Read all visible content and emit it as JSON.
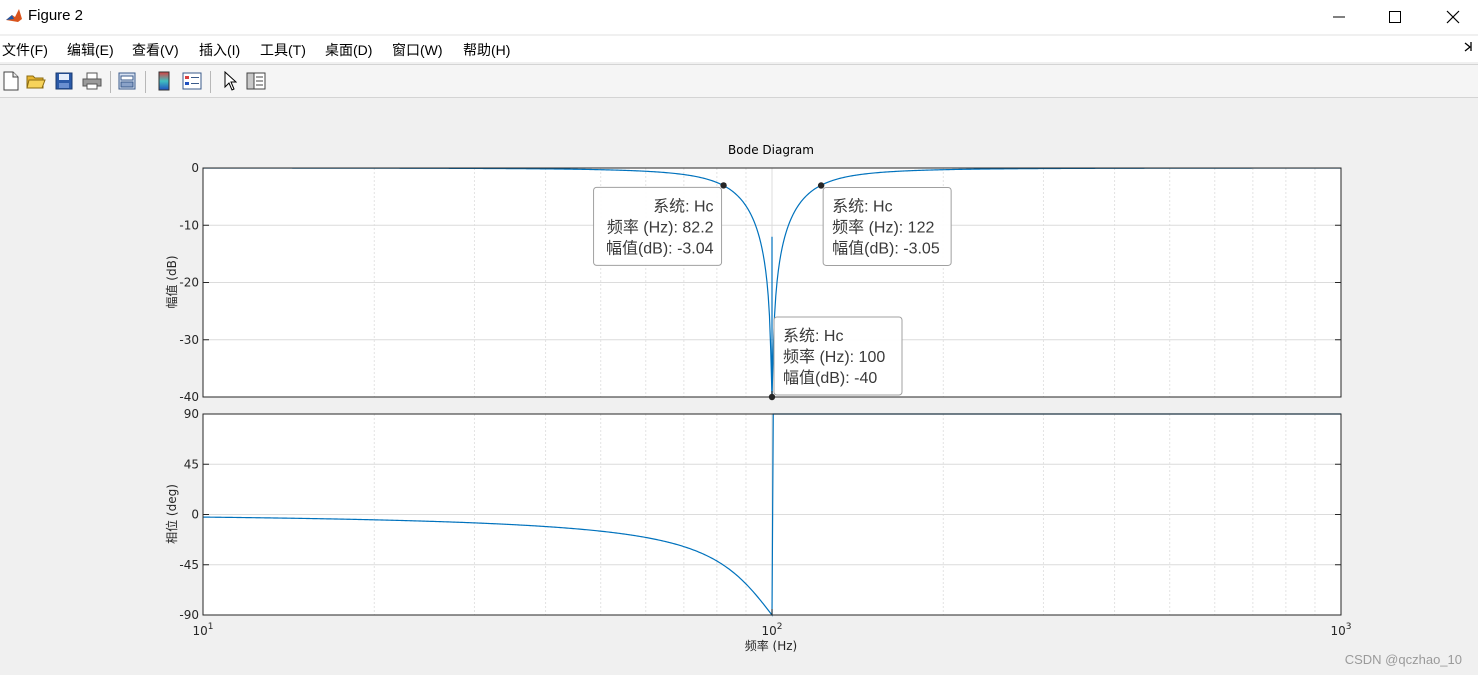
{
  "window": {
    "title": "Figure 2"
  },
  "menu": {
    "items": [
      "文件(F)",
      "编辑(E)",
      "查看(V)",
      "插入(I)",
      "工具(T)",
      "桌面(D)",
      "窗口(W)",
      "帮助(H)"
    ]
  },
  "toolbar": {
    "icons": [
      "new-figure-icon",
      "open-file-icon",
      "save-icon",
      "print-icon",
      "print-preview-icon",
      "colorbar-icon",
      "legend-icon",
      "pointer-icon",
      "property-editor-icon"
    ]
  },
  "chart_data": {
    "type": "line",
    "title": "Bode Diagram",
    "xlabel": "频率  (Hz)",
    "xscale": "log",
    "xlim": [
      10,
      1000
    ],
    "x_ticks": [
      10,
      100,
      1000
    ],
    "x_tick_base": "10",
    "x_tick_exponents": [
      "1",
      "2",
      "3"
    ],
    "system": {
      "type": "notch",
      "center_hz": 100,
      "bandwidth_hz": 40,
      "depth_db": -40
    },
    "magnitude": {
      "ylabel": "幅值 (dB)",
      "ylim": [
        -40,
        0
      ],
      "y_ticks": [
        "0",
        "-10",
        "-20",
        "-30",
        "-40"
      ],
      "points": [
        {
          "x": 10,
          "y": -0.01
        },
        {
          "x": 30,
          "y": -0.13
        },
        {
          "x": 50,
          "y": -0.46
        },
        {
          "x": 70,
          "y": -1.45
        },
        {
          "x": 82.2,
          "y": -3.04
        },
        {
          "x": 90,
          "y": -6.0
        },
        {
          "x": 95,
          "y": -10.6
        },
        {
          "x": 100,
          "y": -40
        },
        {
          "x": 105,
          "y": -11.0
        },
        {
          "x": 110,
          "y": -6.6
        },
        {
          "x": 122,
          "y": -3.05
        },
        {
          "x": 150,
          "y": -1.0
        },
        {
          "x": 300,
          "y": -0.1
        },
        {
          "x": 1000,
          "y": -0.01
        }
      ]
    },
    "phase": {
      "ylabel": "相位 (deg)",
      "ylim": [
        -90,
        90
      ],
      "y_ticks": [
        "90",
        "45",
        "0",
        "-45",
        "-90"
      ],
      "points": [
        {
          "x": 10,
          "y": -2.3
        },
        {
          "x": 30,
          "y": -7.5
        },
        {
          "x": 50,
          "y": -14.9
        },
        {
          "x": 70,
          "y": -30.0
        },
        {
          "x": 82.2,
          "y": -49.4
        },
        {
          "x": 90,
          "y": -65.0
        },
        {
          "x": 96,
          "y": -80.0
        },
        {
          "x": 100,
          "y": 0
        },
        {
          "x": 102,
          "y": 80.0
        },
        {
          "x": 110,
          "y": 60.0
        },
        {
          "x": 122,
          "y": 40.6
        },
        {
          "x": 150,
          "y": 25.6
        },
        {
          "x": 300,
          "y": 9.6
        },
        {
          "x": 1000,
          "y": 2.3
        }
      ]
    },
    "grid": true,
    "line_color": "#0072bd",
    "datatips": [
      {
        "system_line": "系统: Hc",
        "freq_line": "频率 (Hz): 82.2",
        "mag_line": "幅值(dB): -3.04",
        "x": 82.2,
        "y": -3.04,
        "placement": "bottom-left"
      },
      {
        "system_line": "系统: Hc",
        "freq_line": "频率 (Hz): 122",
        "mag_line": "幅值(dB): -3.05",
        "x": 122,
        "y": -3.05,
        "placement": "bottom-right"
      },
      {
        "system_line": "系统: Hc",
        "freq_line": "频率 (Hz): 100",
        "mag_line": "幅值(dB): -40",
        "x": 100,
        "y": -40,
        "placement": "top-right"
      }
    ]
  },
  "watermark": "CSDN @qczhao_10"
}
